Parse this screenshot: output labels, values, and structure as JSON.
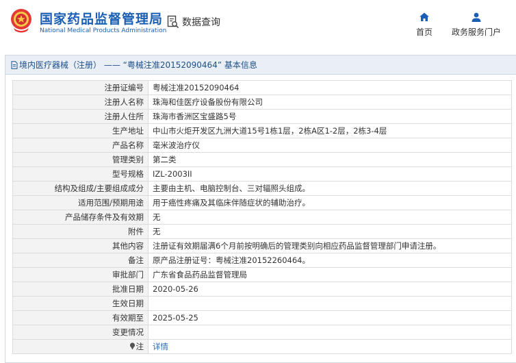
{
  "header": {
    "brand_cn": "国家药品监督管理局",
    "brand_en": "National Medical Products Administration",
    "data_query_label": "数据查询",
    "nav": [
      {
        "label": "首页",
        "icon": "home-icon"
      },
      {
        "label": "政务服务门户",
        "icon": "user-icon"
      }
    ]
  },
  "panel": {
    "title": "境内医疗器械（注册） —— “粤械注准20152090464” 基本信息"
  },
  "rows": [
    {
      "key": "注册证编号",
      "value": "粤械注准20152090464"
    },
    {
      "key": "注册人名称",
      "value": "珠海和佳医疗设备股份有限公司"
    },
    {
      "key": "注册人住所",
      "value": "珠海市香洲区宝盛路5号"
    },
    {
      "key": "生产地址",
      "value": "中山市火炬开发区九洲大道15号1栋1层，2栋A区1-2层，2栋3-4层"
    },
    {
      "key": "产品名称",
      "value": "毫米波治疗仪"
    },
    {
      "key": "管理类别",
      "value": "第二类"
    },
    {
      "key": "型号规格",
      "value": "IZL-2003II"
    },
    {
      "key": "结构及组成/主要组成成分",
      "value": "主要由主机、电脑控制台、三对辐照头组成。"
    },
    {
      "key": "适用范围/预期用途",
      "value": "用于癌性疼痛及其临床伴随症状的辅助治疗。"
    },
    {
      "key": "产品储存条件及有效期",
      "value": "无"
    },
    {
      "key": "附件",
      "value": "无"
    },
    {
      "key": "其他内容",
      "value": "注册证有效期届满6个月前按明确后的管理类别向相应药品监督管理部门申请注册。"
    },
    {
      "key": "备注",
      "value": "原产品注册证号：粤械注准20152260464。"
    },
    {
      "key": "审批部门",
      "value": "广东省食品药品监督管理局"
    },
    {
      "key": "批准日期",
      "value": "2020-05-26"
    },
    {
      "key": "生效日期",
      "value": ""
    },
    {
      "key": "有效期至",
      "value": "2025-05-25"
    },
    {
      "key": "变更情况",
      "value": ""
    },
    {
      "key": "注",
      "value": "详情",
      "icon": "note-icon",
      "is_link": true
    }
  ],
  "colors": {
    "brand_blue": "#1a5fb4",
    "title_bar": "#e9eff5",
    "label_bg": "#f3f3f3",
    "link": "#2a6bb3"
  }
}
